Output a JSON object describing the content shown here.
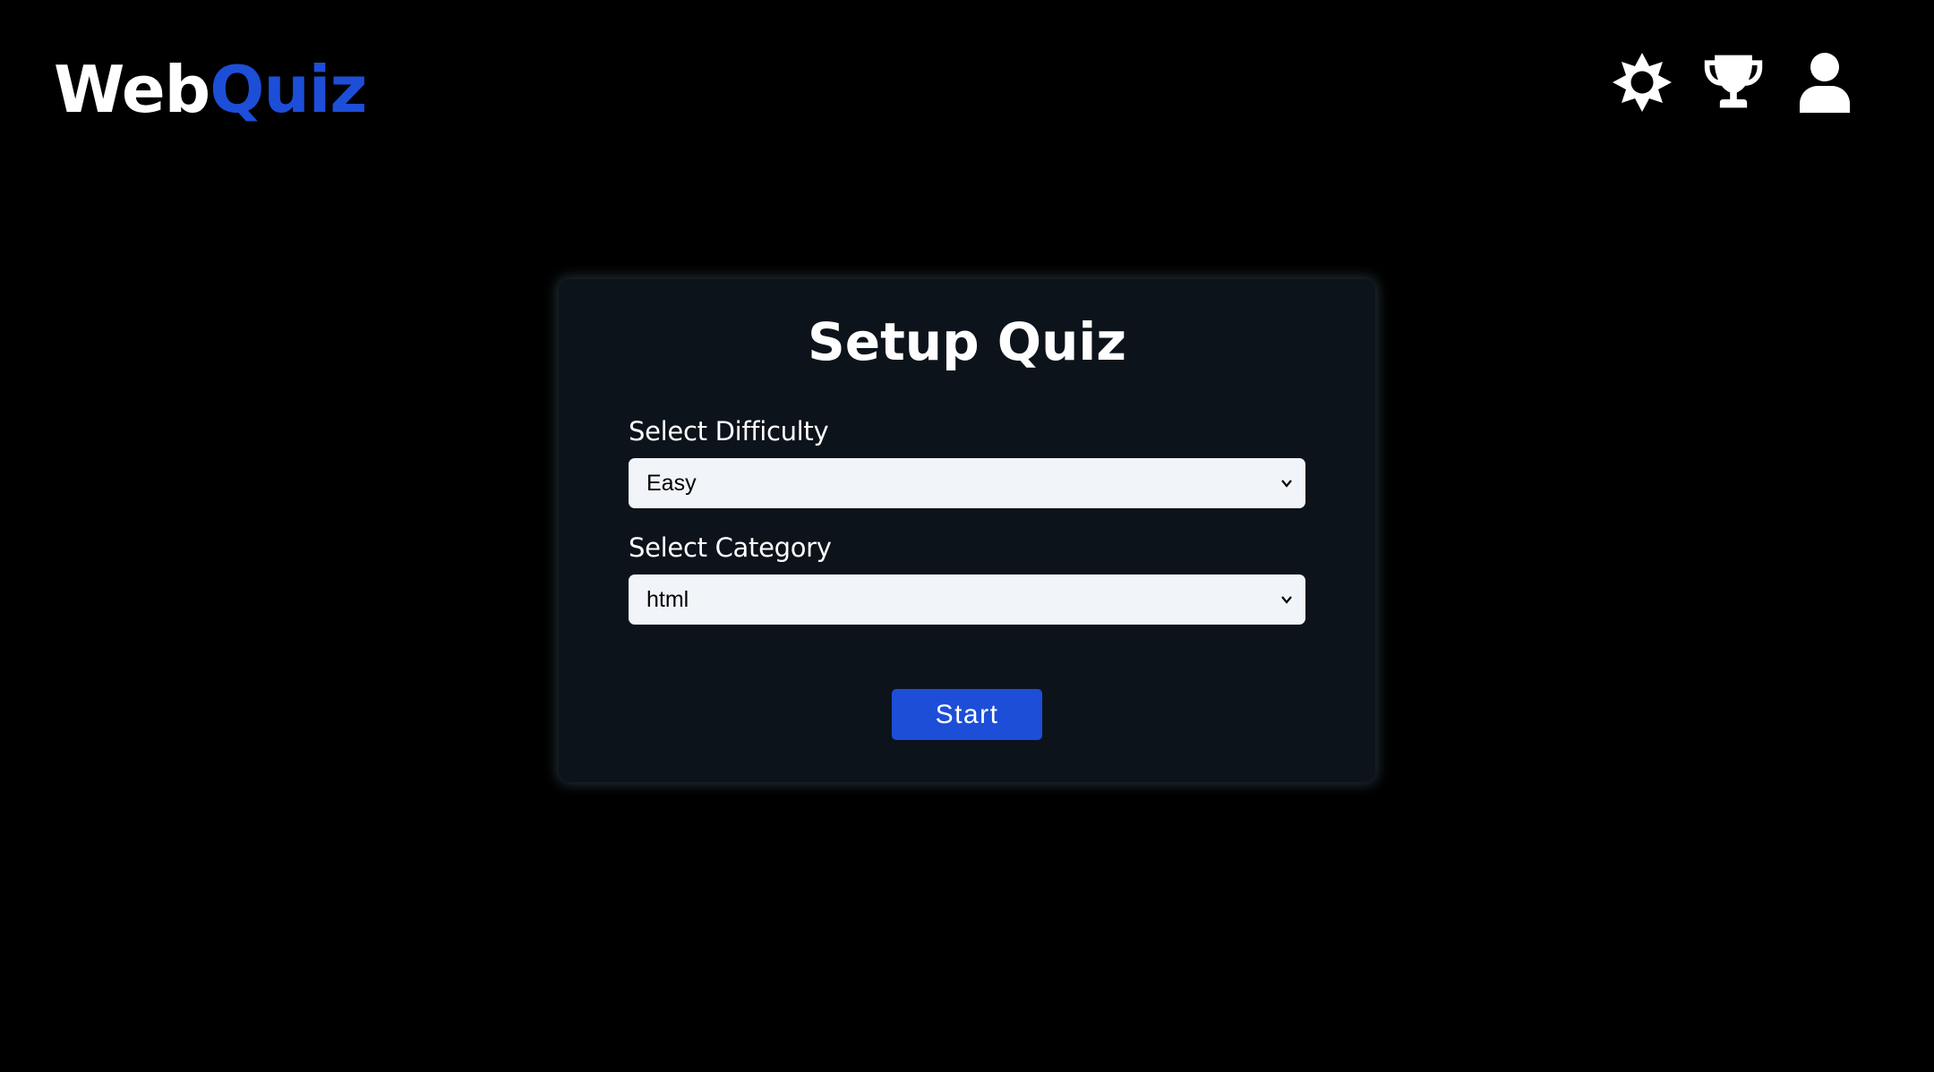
{
  "header": {
    "logo_part1": "Web",
    "logo_part2": "Quiz",
    "icons": [
      "theme-toggle-sun-icon",
      "leaderboard-trophy-icon",
      "user-profile-icon"
    ]
  },
  "card": {
    "title": "Setup Quiz",
    "difficulty_label": "Select Difficulty",
    "difficulty_value": "Easy",
    "category_label": "Select Category",
    "category_value": "html",
    "start_label": "Start"
  },
  "colors": {
    "background": "#000000",
    "card": "#0d131b",
    "accent": "#1d4ed8",
    "select_bg": "#f1f5f9"
  }
}
